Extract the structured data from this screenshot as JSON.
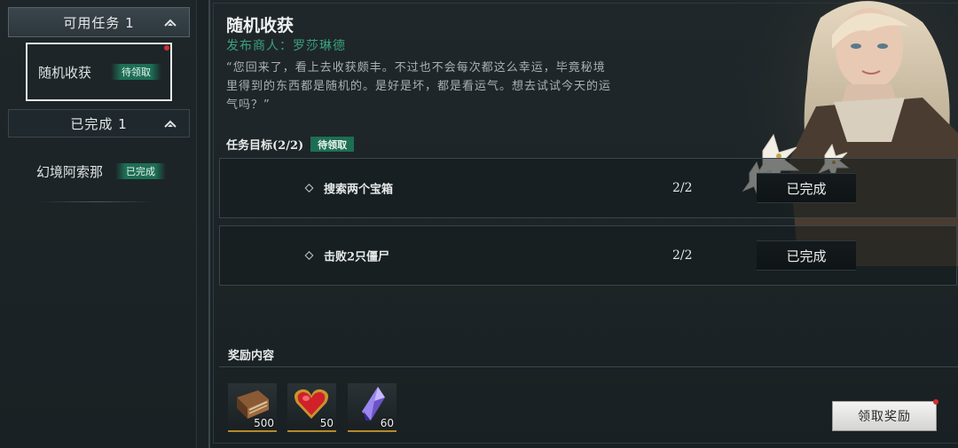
{
  "sidebar": {
    "available_header": "可用任务 1",
    "available_tasks": [
      {
        "name": "随机收获",
        "status": "待领取"
      }
    ],
    "completed_header": "已完成 1",
    "completed_tasks": [
      {
        "name": "幻境阿索那",
        "status": "已完成"
      }
    ]
  },
  "quest": {
    "title": "随机收获",
    "giver": "发布商人：罗莎琳德",
    "description": "“您回来了，看上去收获颇丰。不过也不会每次都这么幸运，毕竟秘境里得到的东西都是随机的。是好是坏，都是看运气。想去试试今天的运气吗？”",
    "objectives_label": "任务目标(2/2)",
    "objectives_badge": "待领取",
    "objectives": [
      {
        "name": "搜索两个宝箱",
        "progress": "2/2",
        "status": "已完成"
      },
      {
        "name": "击败2只僵尸",
        "progress": "2/2",
        "status": "已完成"
      }
    ]
  },
  "rewards": {
    "label": "奖励内容",
    "items": [
      {
        "icon": "book-icon",
        "quantity": "500"
      },
      {
        "icon": "heart-gem-icon",
        "quantity": "50"
      },
      {
        "icon": "crystal-icon",
        "quantity": "60"
      }
    ],
    "claim_label": "领取奖励"
  },
  "colors": {
    "accent_green": "#1d6e54",
    "giver_green": "#3aa07c",
    "reward_gold": "#b48a2a",
    "notify_red": "#d23030"
  }
}
